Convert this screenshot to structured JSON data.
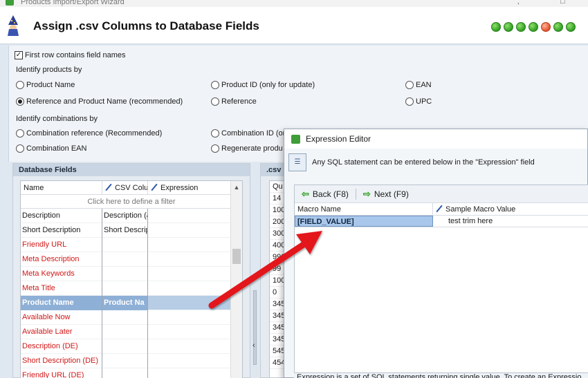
{
  "window": {
    "title": "Products Import/Export Wizard"
  },
  "header": {
    "title": "Assign .csv Columns to Database Fields",
    "step_count": 7,
    "active_step": 5
  },
  "options": {
    "first_row_label": "First row contains field names",
    "first_row_checked": true,
    "identify_products_label": "Identify products by",
    "product_options": [
      {
        "label": "Product Name",
        "selected": false
      },
      {
        "label": "Product ID (only for update)",
        "selected": false
      },
      {
        "label": "EAN",
        "selected": false
      },
      {
        "label": "Reference and Product Name (recommended)",
        "selected": true
      },
      {
        "label": "Reference",
        "selected": false
      },
      {
        "label": "UPC",
        "selected": false
      }
    ],
    "identify_combinations_label": "Identify combinations by",
    "combination_options": [
      {
        "label": "Combination reference (Recommended)",
        "selected": false
      },
      {
        "label": "Combination ID (or",
        "selected": false
      },
      {
        "label": "Combination EAN",
        "selected": false
      },
      {
        "label": "Regenerate produ",
        "selected": false
      }
    ]
  },
  "database_fields": {
    "title": "Database Fields",
    "columns": [
      "Name",
      "CSV Colu",
      "Expression"
    ],
    "filter_text": "Click here to define a filter",
    "rows": [
      {
        "name": "Description",
        "csv": "Description (&",
        "highlight": false,
        "required": false
      },
      {
        "name": "Short Description",
        "csv": "Short Descrip",
        "highlight": false,
        "required": false
      },
      {
        "name": "Friendly URL",
        "csv": "",
        "highlight": false,
        "required": true
      },
      {
        "name": "Meta Description",
        "csv": "",
        "highlight": false,
        "required": true
      },
      {
        "name": "Meta Keywords",
        "csv": "",
        "highlight": false,
        "required": true
      },
      {
        "name": "Meta Title",
        "csv": "",
        "highlight": false,
        "required": true
      },
      {
        "name": "Product Name",
        "csv": "Product Na",
        "highlight": true,
        "required": true
      },
      {
        "name": "Available Now",
        "csv": "",
        "highlight": false,
        "required": true
      },
      {
        "name": "Available Later",
        "csv": "",
        "highlight": false,
        "required": true
      },
      {
        "name": "Description (DE)",
        "csv": "",
        "highlight": false,
        "required": true
      },
      {
        "name": "Short Description (DE)",
        "csv": "",
        "highlight": false,
        "required": true
      },
      {
        "name": "Friendly URL (DE)",
        "csv": "",
        "highlight": false,
        "required": true
      }
    ]
  },
  "csv_panel": {
    "title": ".csv",
    "column_header": "Qu",
    "values": [
      "14",
      "100",
      "200",
      "300",
      "400",
      "990",
      "99",
      "100",
      "0",
      "345",
      "345",
      "345",
      "345",
      "545",
      "454"
    ]
  },
  "expression_editor": {
    "title": "Expression Editor",
    "info": "Any SQL statement can be entered below in the \"Expression\" field",
    "back_label": "Back (F8)",
    "next_label": "Next (F9)",
    "columns": [
      "Macro Name",
      "Sample Macro Value"
    ],
    "macro_name": "[FIELD_VALUE]",
    "macro_value": "test trim here",
    "footer": "Expression is a set of SQL statements returning single value. To create an Expressio"
  },
  "colors": {
    "accent_red": "#d01818",
    "selection": "#8fb0d6",
    "step_green": "#2f9e22",
    "step_active": "#e3502a"
  }
}
